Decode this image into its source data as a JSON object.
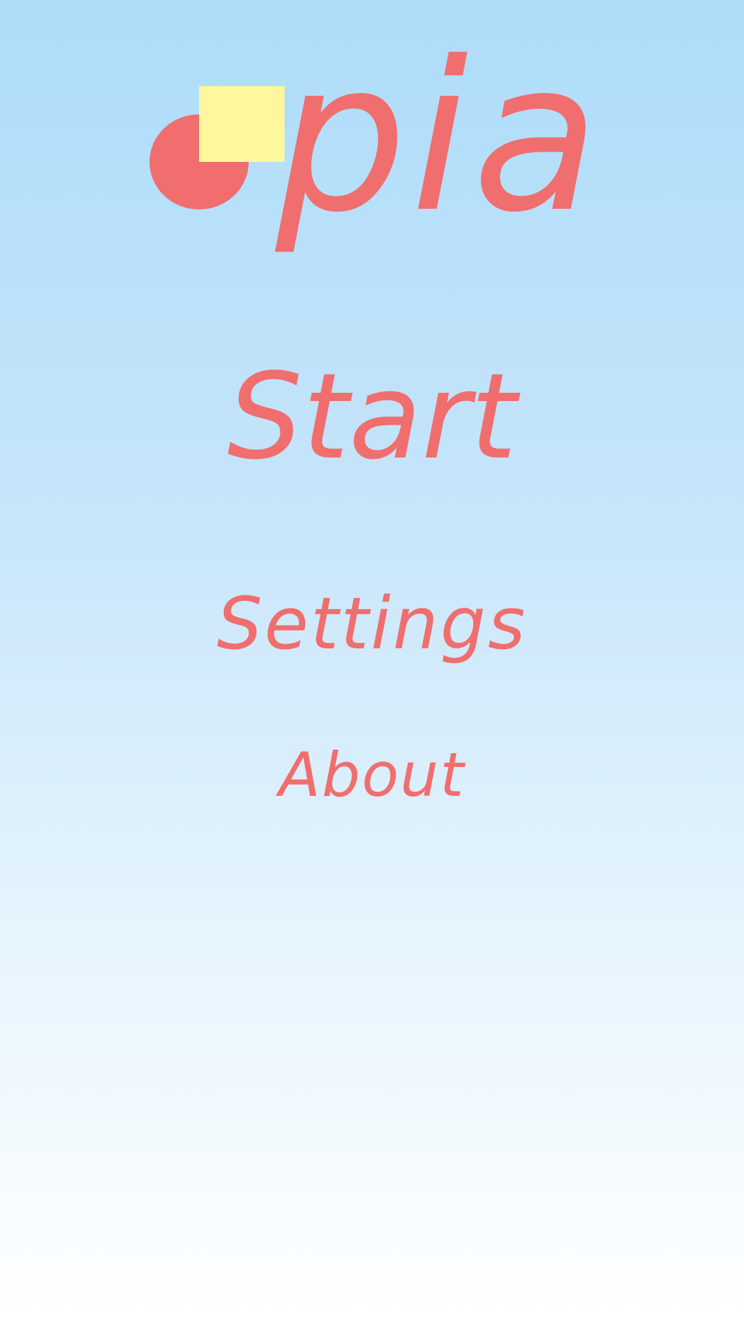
{
  "logo": {
    "text": "pia",
    "circle_color": "#F06E6E",
    "square_color": "#FFF79D",
    "text_color": "#F06E6E",
    "shapes": [
      "circle",
      "square"
    ]
  },
  "menu": {
    "items": [
      {
        "label": "Start"
      },
      {
        "label": "Settings"
      },
      {
        "label": "About"
      }
    ],
    "text_color": "#F06E6E"
  },
  "background": {
    "gradient_top": "#ADDCF9",
    "gradient_bottom": "#FFFFFF"
  }
}
